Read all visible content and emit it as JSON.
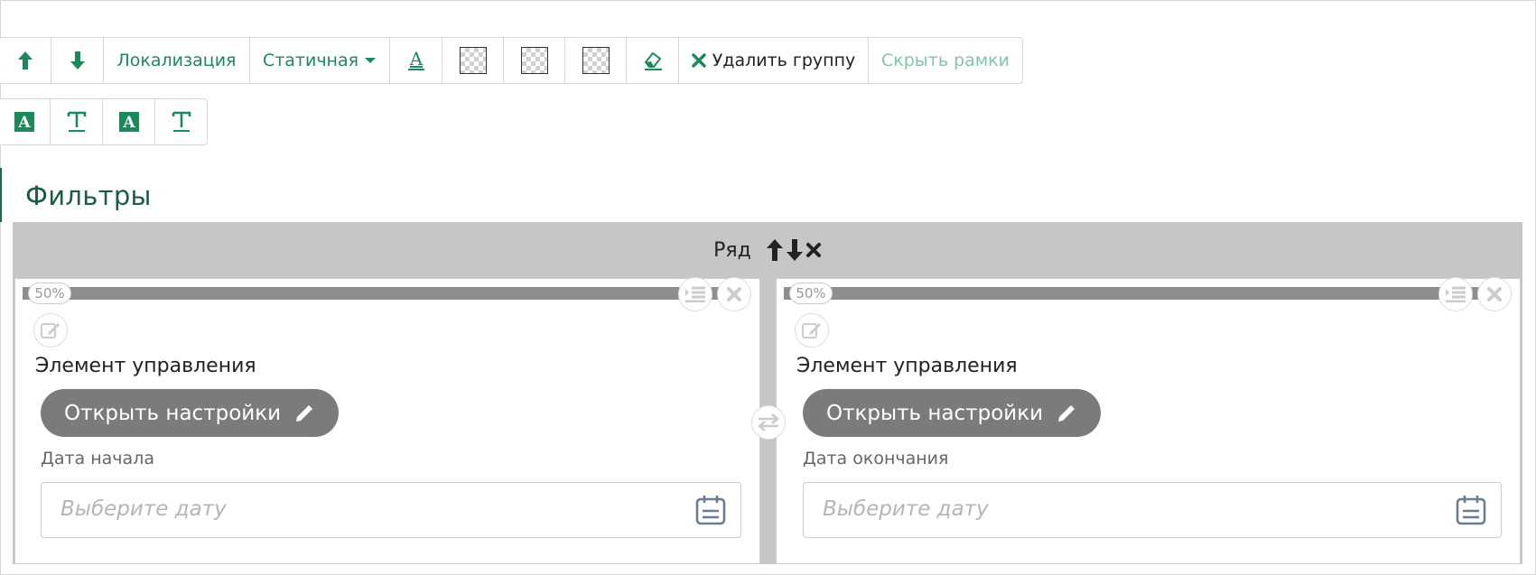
{
  "toolbar": {
    "localization": "Локализация",
    "static": "Статичная",
    "delete_group": "Удалить группу",
    "hide_frames": "Скрыть рамки"
  },
  "section": {
    "title": "Фильтры"
  },
  "row": {
    "label": "Ряд"
  },
  "columns": [
    {
      "width": "50%",
      "element_label": "Элемент управления",
      "open_settings": "Открыть настройки",
      "field_label": "Дата начала",
      "placeholder": "Выберите дату"
    },
    {
      "width": "50%",
      "element_label": "Элемент управления",
      "open_settings": "Открыть настройки",
      "field_label": "Дата окончания",
      "placeholder": "Выберите дату"
    }
  ],
  "colors": {
    "accent": "#1b8a5a",
    "title": "#1d5b44",
    "row_bg": "#c6c6c6",
    "button": "#7b7b7b"
  }
}
